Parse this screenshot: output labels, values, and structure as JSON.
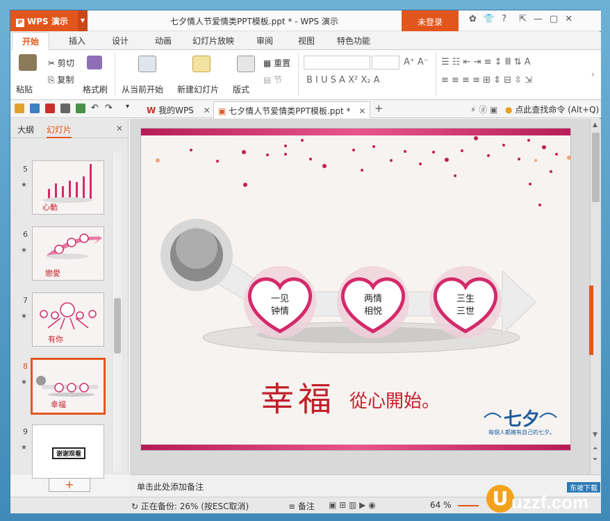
{
  "app": {
    "name": "WPS 演示",
    "doc_title": "七夕情人节爱情类PPT模板.ppt * - WPS 演示",
    "login_label": "未登录",
    "help": "?"
  },
  "tabs": [
    "开始",
    "插入",
    "设计",
    "动画",
    "幻灯片放映",
    "审阅",
    "视图",
    "特色功能"
  ],
  "ribbon": {
    "paste": "粘贴",
    "cut": "剪切",
    "copy": "复制",
    "format_painter": "格式刷",
    "from_current": "从当前开始",
    "new_slide": "新建幻灯片",
    "layout": "版式",
    "reset": "重置",
    "section": "节"
  },
  "doc_tabs": {
    "home": "我的WPS",
    "current": "七夕情人节爱情类PPT模板.ppt *",
    "search_cmd": "点此查找命令 (Alt+Q)"
  },
  "left_panel": {
    "outline_tab": "大纲",
    "slides_tab": "幻灯片",
    "add": "+"
  },
  "thumbnails": [
    {
      "num": "5",
      "caption": "心動"
    },
    {
      "num": "6",
      "caption": "戀愛"
    },
    {
      "num": "7",
      "caption": "有你"
    },
    {
      "num": "8",
      "caption": "幸福"
    },
    {
      "num": "9",
      "caption": "谢谢观看"
    }
  ],
  "slide": {
    "hearts": [
      {
        "line1": "一见",
        "line2": "钟情"
      },
      {
        "line1": "两情",
        "line2": "相悦"
      },
      {
        "line1": "三生",
        "line2": "三世"
      }
    ],
    "title_big": "幸福",
    "title_small": "從心開始。",
    "logo": "七夕",
    "logo_sub": "每個人都擁有自己的七夕。"
  },
  "notes_placeholder": "单击此处添加备注",
  "status": {
    "backup": "正在备份: 26% (按ESC取消)",
    "notes": "备注",
    "zoom": "64 %"
  },
  "watermark": {
    "site": "uzzf.com",
    "tag": "东坡下载"
  },
  "colors": {
    "accent": "#e2561d",
    "heart": "#d42a6a",
    "title_red": "#c2202a"
  }
}
